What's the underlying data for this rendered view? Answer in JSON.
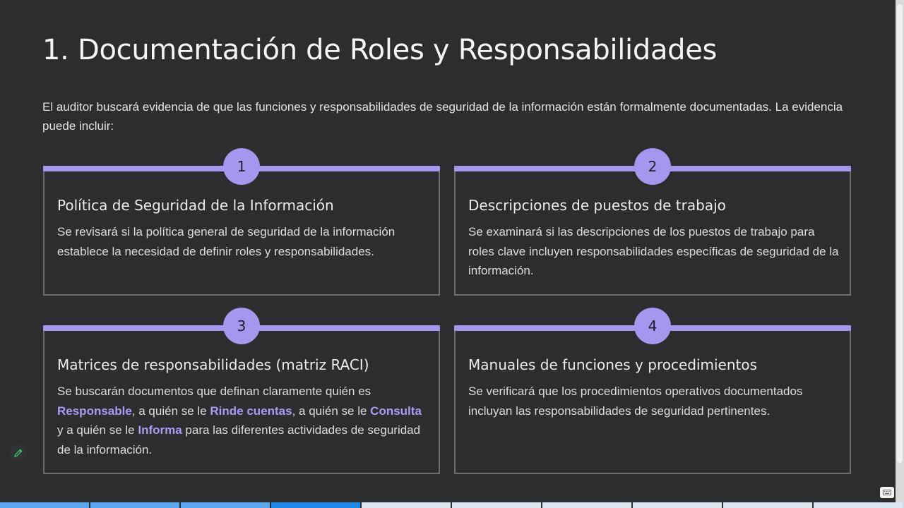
{
  "slide": {
    "title": "1. Documentación de Roles y Responsabilidades",
    "intro": "El auditor buscará evidencia de que las funciones y responsabilidades de seguridad de la información están formalmente documentadas. La evidencia puede incluir:"
  },
  "cards": [
    {
      "number": "1",
      "title": "Política de Seguridad de la Información",
      "text": "Se revisará si la política general de seguridad de la información establece la necesidad de definir roles y responsabilidades."
    },
    {
      "number": "2",
      "title": "Descripciones de puestos de trabajo",
      "text": "Se examinará si las descripciones de los puestos de trabajo para roles clave incluyen responsabilidades específicas de seguridad de la información."
    },
    {
      "number": "3",
      "title": "Matrices de responsabilidades (matriz RACI)",
      "text_parts": [
        "Se buscarán documentos que definan claramente quién es ",
        "Responsable",
        ", a quién se le ",
        "Rinde cuentas",
        ", a quién se le ",
        "Consulta",
        " y a quién se le ",
        "Informa",
        " para las diferentes actividades de seguridad de la información."
      ]
    },
    {
      "number": "4",
      "title": "Manuales de funciones y procedimientos",
      "text": "Se verificará que los procedimientos operativos documentados incluyan las responsabilidades de seguridad pertinentes."
    }
  ],
  "colors": {
    "accent": "#a597ee",
    "background": "#2b2d2e",
    "highlight": "#a99cf4"
  },
  "icons": {
    "edit": "pencil-icon",
    "corner": "keyboard-icon"
  },
  "progress": {
    "total_slides": 10,
    "current_slide": 4,
    "colors": [
      "#5aa6f0",
      "#5aa6f0",
      "#5aa6f0",
      "#1e87e8",
      "#d9e6f2",
      "#d9e6f2",
      "#d9e6f2",
      "#d9e6f2",
      "#d9e6f2",
      "#d9e6f2"
    ]
  }
}
